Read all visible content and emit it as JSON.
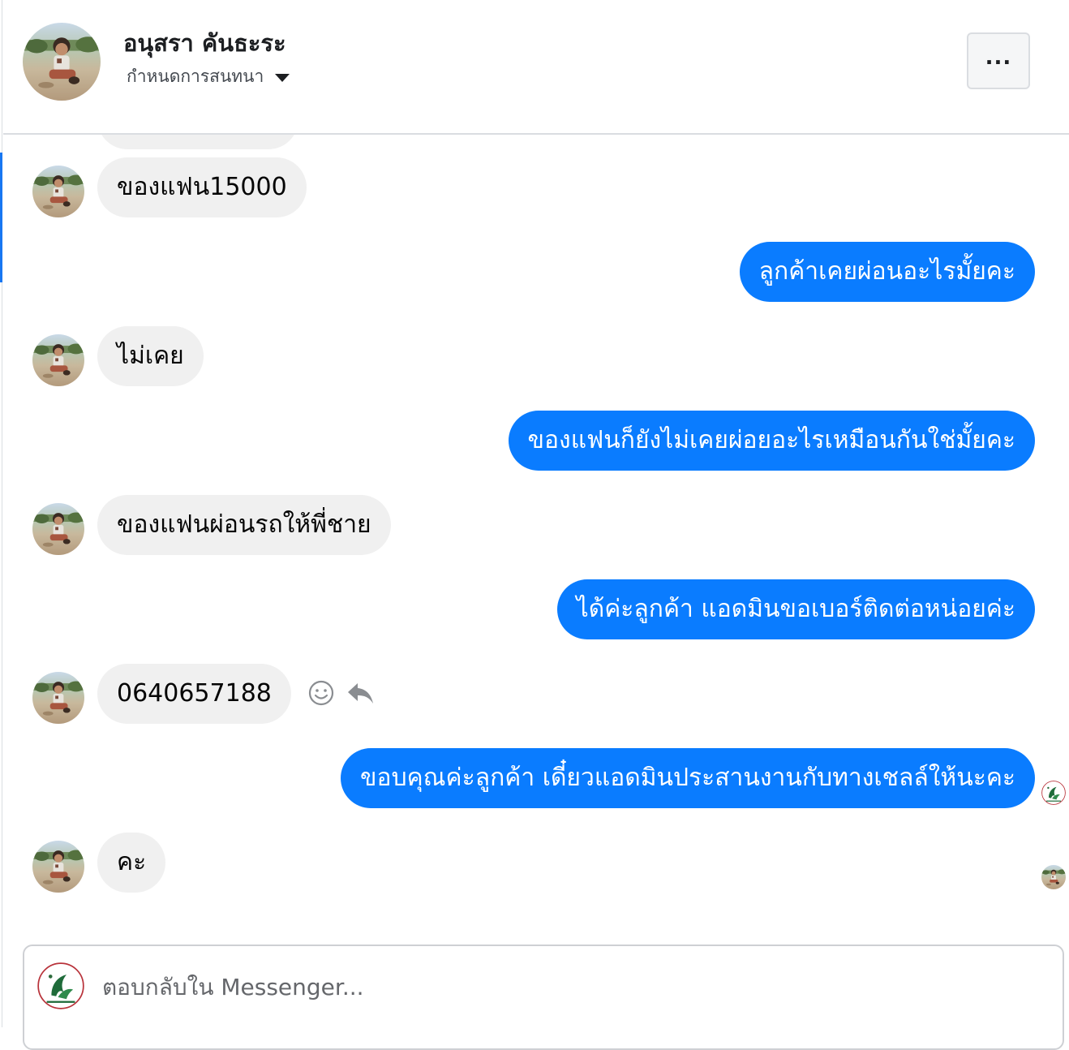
{
  "header": {
    "contact_name": "อนุสรา คันธะระ",
    "assign_label": "กำหนดการสนทนา",
    "more_label": "..."
  },
  "messages": [
    {
      "side": "in",
      "text": "ของแฟน15000"
    },
    {
      "side": "out",
      "text": "ลูกค้าเคยผ่อนอะไรมั้ยคะ"
    },
    {
      "side": "in",
      "text": "ไม่เคย"
    },
    {
      "side": "out",
      "text": "ของแฟนก็ยังไม่เคยผ่อยอะไรเหมือนกันใช่มั้ยคะ"
    },
    {
      "side": "in",
      "text": "ของแฟนผ่อนรถให้พี่ชาย"
    },
    {
      "side": "out",
      "text": "ได้ค่ะลูกค้า แอดมินขอเบอร์ติดต่อหน่อยค่ะ"
    },
    {
      "side": "in",
      "text": "0640657188"
    },
    {
      "side": "out",
      "text": "ขอบคุณค่ะลูกค้า เดี๋ยวแอดมินประสานงานกับทางเชลล์ให้นะคะ"
    },
    {
      "side": "in",
      "text": "คะ"
    }
  ],
  "hover_actions": [
    "smiley-react-icon",
    "reply-arrow-icon"
  ],
  "composer": {
    "placeholder": "ตอบกลับใน Messenger..."
  },
  "colors": {
    "outgoing_bubble": "#0a7cff",
    "incoming_bubble": "#f0f0f0",
    "accent": "#1877f2"
  }
}
